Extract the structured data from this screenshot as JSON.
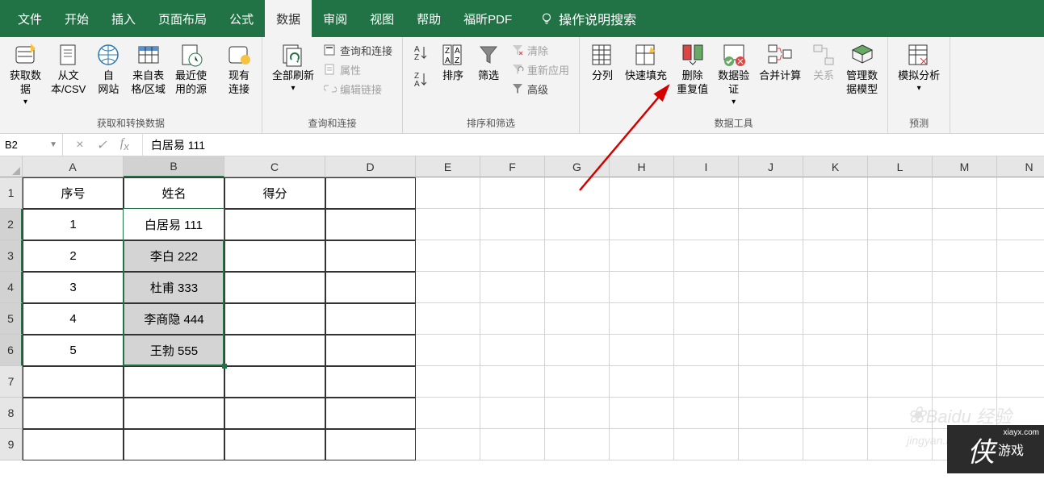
{
  "menu": {
    "file": "文件",
    "home": "开始",
    "insert": "插入",
    "layout": "页面布局",
    "formula": "公式",
    "data": "数据",
    "review": "审阅",
    "view": "视图",
    "help": "帮助",
    "foxit": "福昕PDF",
    "tell_me": "操作说明搜索"
  },
  "ribbon": {
    "group1_label": "获取和转换数据",
    "get_data": "获取数\n据",
    "from_csv": "从文\n本/CSV",
    "from_web": "自\n网站",
    "from_table": "来自表\n格/区域",
    "recent": "最近使\n用的源",
    "existing": "现有\n连接",
    "group2_label": "查询和连接",
    "refresh": "全部刷新",
    "queries": "查询和连接",
    "props": "属性",
    "edit_links": "编辑链接",
    "group3_label": "排序和筛选",
    "sort": "排序",
    "filter": "筛选",
    "clear": "清除",
    "reapply": "重新应用",
    "advanced": "高级",
    "group4_label": "数据工具",
    "text_cols": "分列",
    "flash_fill": "快速填充",
    "remove_dup": "删除\n重复值",
    "data_val": "数据验\n证",
    "consolidate": "合并计算",
    "relations": "关系",
    "data_model": "管理数\n据模型",
    "group5_label": "预测",
    "whatif": "模拟分析"
  },
  "namebox": "B2",
  "formula": "白居易 111",
  "columns": [
    "A",
    "B",
    "C",
    "D",
    "E",
    "F",
    "G",
    "H",
    "I",
    "J",
    "K",
    "L",
    "M",
    "N"
  ],
  "rows": [
    "1",
    "2",
    "3",
    "4",
    "5",
    "6",
    "7",
    "8",
    "9"
  ],
  "data": {
    "A1": "序号",
    "B1": "姓名",
    "C1": "得分",
    "A2": "1",
    "B2": "白居易 111",
    "A3": "2",
    "B3": "李白 222",
    "A4": "3",
    "B4": "杜甫 333",
    "A5": "4",
    "B5": "李商隐 444",
    "A6": "5",
    "B6": "王勃 555"
  },
  "watermark": {
    "baidu": "Baidu 经验",
    "baidu_sub": "jingyan.baidu",
    "corner": "侠 游戏",
    "corner_url": "xiayx.com"
  }
}
